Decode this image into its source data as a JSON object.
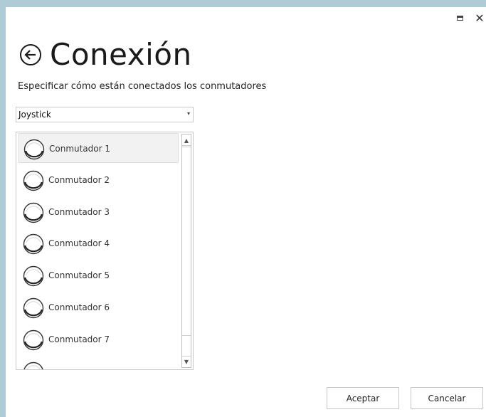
{
  "window": {
    "maximize_icon": "maximize-icon",
    "close_icon": "close-icon",
    "close_glyph": "✕"
  },
  "header": {
    "back_icon": "back-arrow-circle-icon",
    "title": "Conexión",
    "subtitle": "Especificar cómo están conectados los conmutadores"
  },
  "connection_select": {
    "selected": "Joystick",
    "arrow_glyph": "▾"
  },
  "switch_list": {
    "items": [
      {
        "label": "Conmutador 1",
        "selected": true
      },
      {
        "label": "Conmutador 2",
        "selected": false
      },
      {
        "label": "Conmutador 3",
        "selected": false
      },
      {
        "label": "Conmutador 4",
        "selected": false
      },
      {
        "label": "Conmutador 5",
        "selected": false
      },
      {
        "label": "Conmutador 6",
        "selected": false
      },
      {
        "label": "Conmutador 7",
        "selected": false
      },
      {
        "label": "",
        "selected": false
      }
    ],
    "item_icon": "switch-button-icon",
    "scroll_up_glyph": "▲",
    "scroll_down_glyph": "▼"
  },
  "footer": {
    "accept_label": "Aceptar",
    "cancel_label": "Cancelar"
  }
}
